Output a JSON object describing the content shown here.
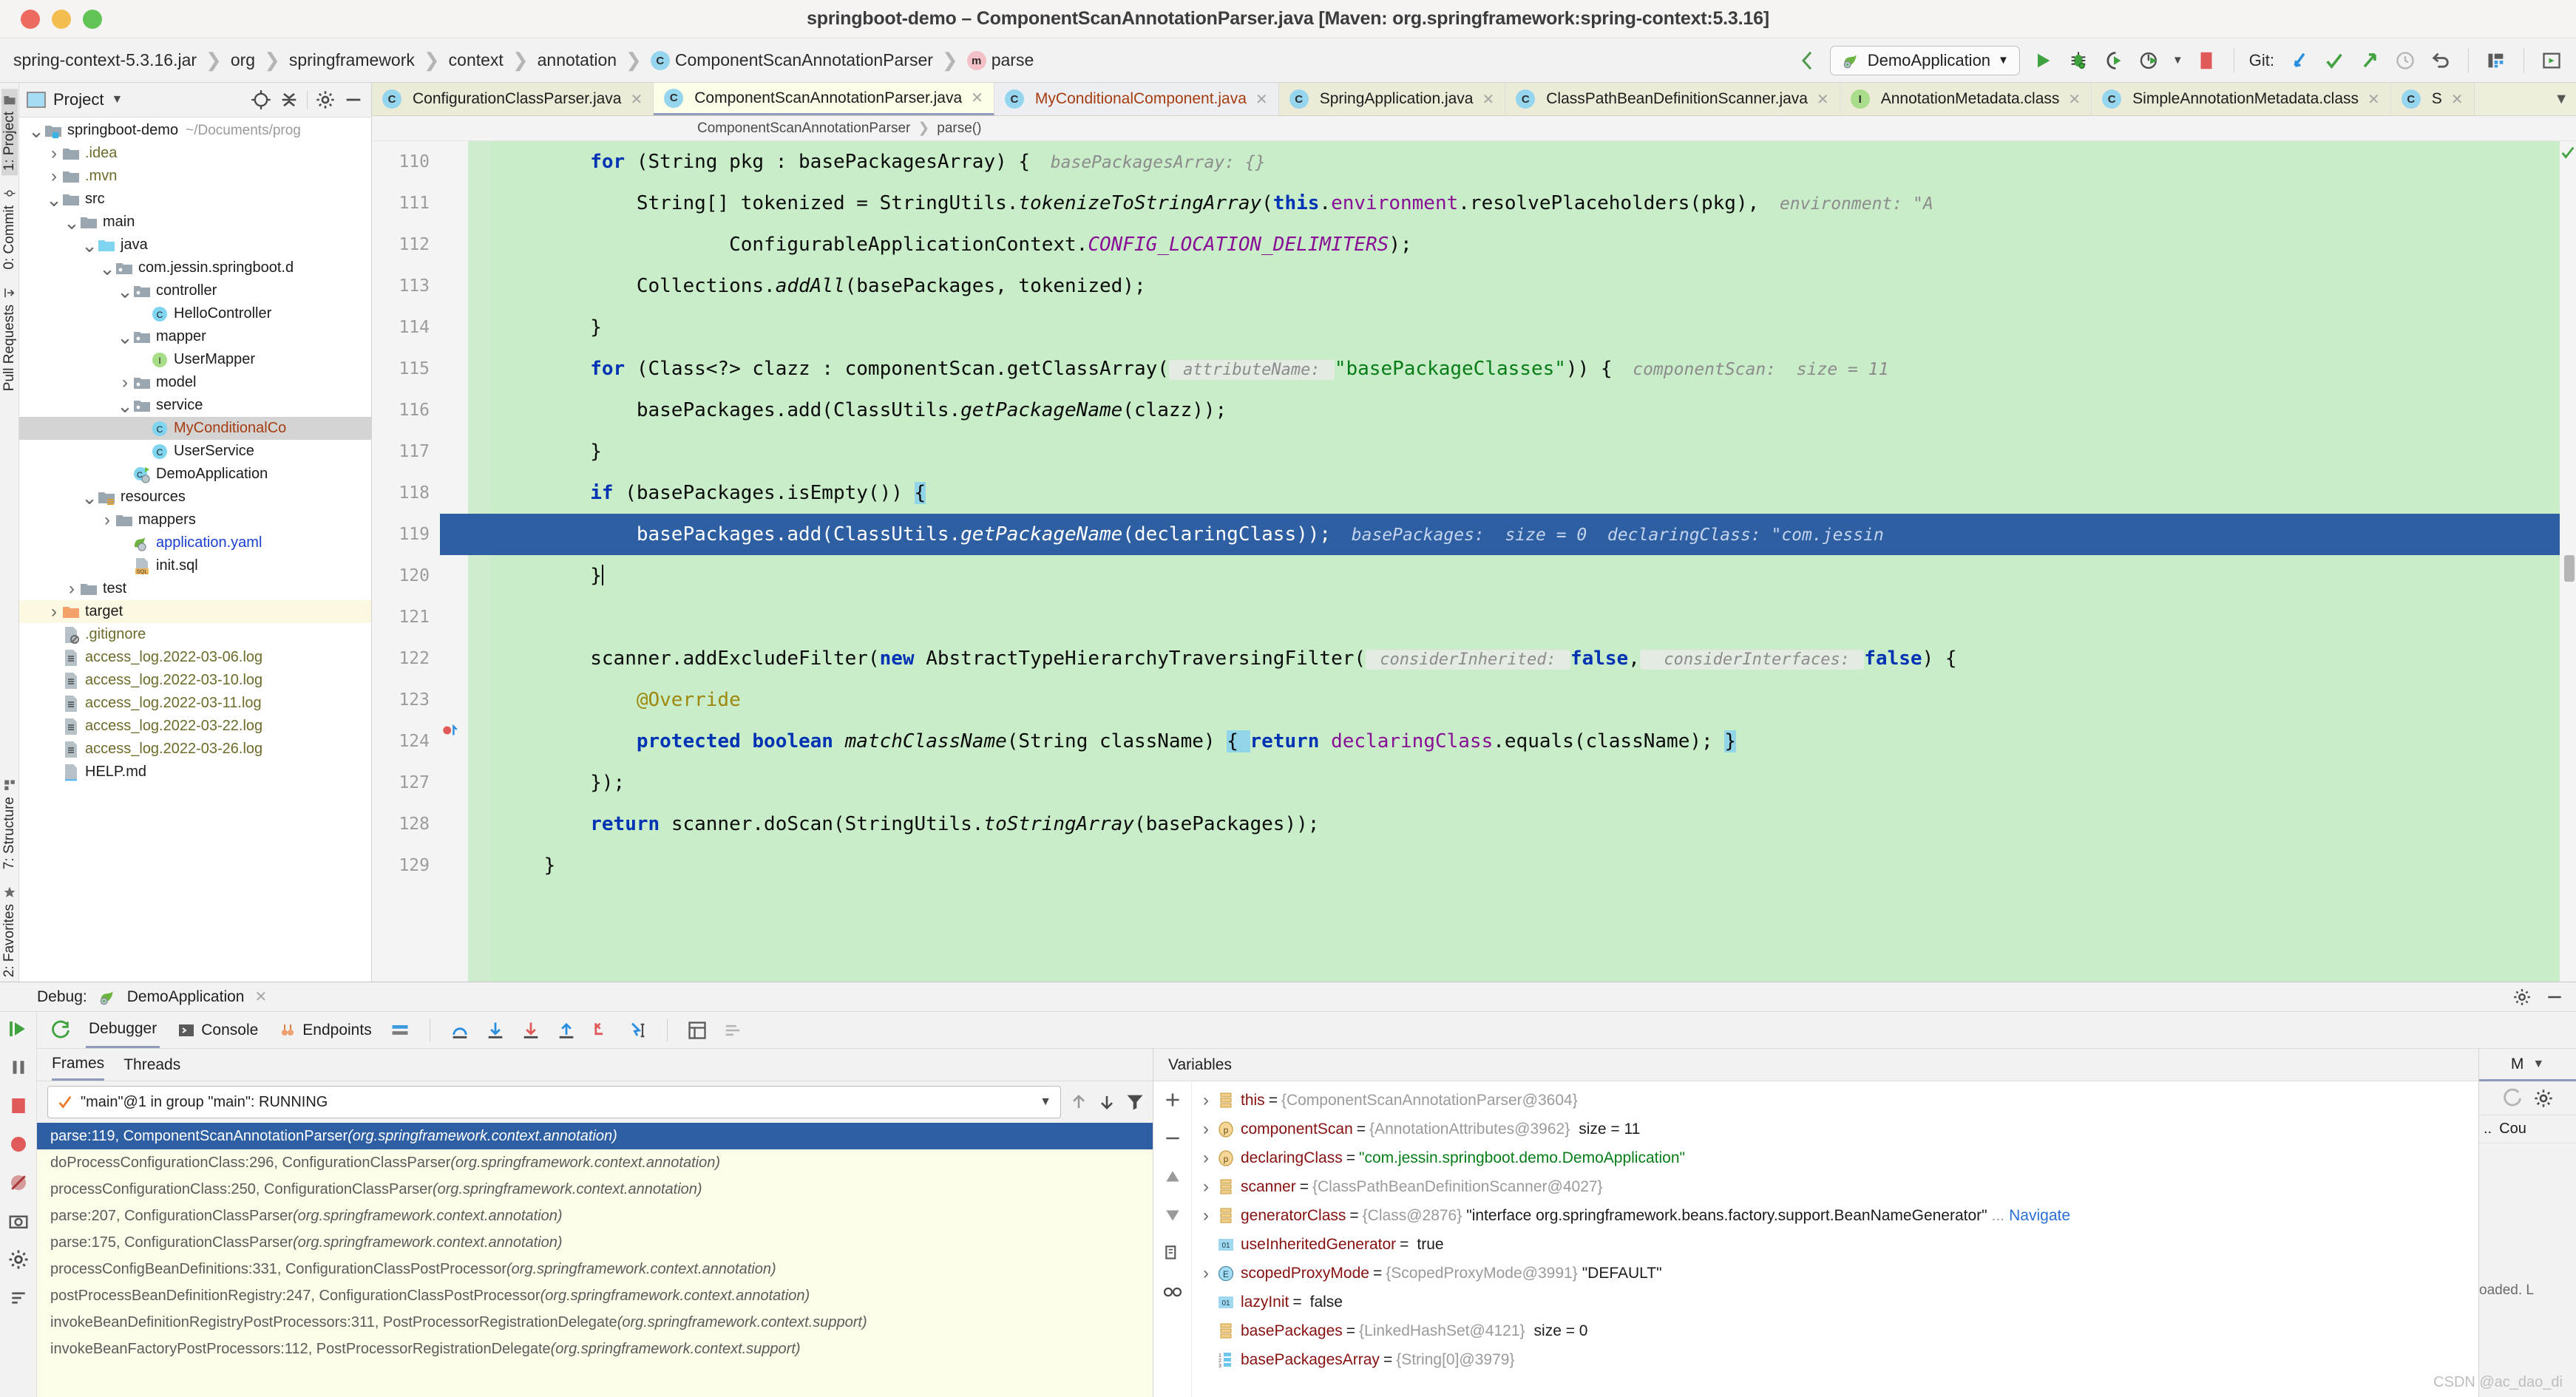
{
  "window": {
    "title": "springboot-demo – ComponentScanAnnotationParser.java [Maven: org.springframework:spring-context:5.3.16]",
    "traffic_lights": [
      "close-red",
      "minimize-yellow",
      "maximize-green"
    ]
  },
  "navbar": {
    "breadcrumbs": [
      {
        "label": "spring-context-5.3.16.jar",
        "icon": null
      },
      {
        "label": "org",
        "icon": null
      },
      {
        "label": "springframework",
        "icon": null
      },
      {
        "label": "context",
        "icon": null
      },
      {
        "label": "annotation",
        "icon": null
      },
      {
        "label": "ComponentScanAnnotationParser",
        "icon": "class-badge",
        "badge": "C"
      },
      {
        "label": "parse",
        "icon": "method-badge",
        "badge": "m"
      }
    ],
    "run_config": "DemoApplication",
    "git_label": "Git:",
    "icons": [
      "back-arrow-icon",
      "run-icon",
      "debug-icon",
      "run-with-coverage-icon",
      "profiler-icon",
      "stop-icon",
      "git-update-icon",
      "git-commit-icon",
      "git-push-icon",
      "git-history-icon",
      "git-rollback-icon",
      "build-icon",
      "search-everywhere-icon"
    ]
  },
  "left_strip": {
    "items": [
      {
        "label": "1: Project",
        "icon": "folder-icon",
        "active": true
      },
      {
        "label": "0: Commit",
        "icon": "commit-icon",
        "active": false
      },
      {
        "label": "Pull Requests",
        "icon": "pull-request-icon",
        "active": false
      }
    ],
    "bottom_items": [
      {
        "label": "7: Structure",
        "icon": "structure-icon"
      },
      {
        "label": "2: Favorites",
        "icon": "star-icon"
      }
    ]
  },
  "project_panel": {
    "header_title": "Project",
    "header_icons": [
      "project-scope-icon",
      "locate-icon",
      "collapse-all-icon",
      "settings-gear-icon",
      "hide-icon"
    ],
    "tree": [
      {
        "indent": 0,
        "twisty": "v",
        "icon": "module-folder",
        "label": "springboot-demo",
        "path": "~/Documents/prog",
        "style": "dir"
      },
      {
        "indent": 1,
        "twisty": ">",
        "icon": "folder",
        "label": ".idea",
        "style": "olive"
      },
      {
        "indent": 1,
        "twisty": ">",
        "icon": "folder",
        "label": ".mvn",
        "style": "olive"
      },
      {
        "indent": 1,
        "twisty": "v",
        "icon": "folder",
        "label": "src",
        "style": "dir"
      },
      {
        "indent": 2,
        "twisty": "v",
        "icon": "folder",
        "label": "main",
        "style": "dir"
      },
      {
        "indent": 3,
        "twisty": "v",
        "icon": "source-folder",
        "label": "java",
        "style": "dir"
      },
      {
        "indent": 4,
        "twisty": "v",
        "icon": "package",
        "label": "com.jessin.springboot.d",
        "style": "dir"
      },
      {
        "indent": 5,
        "twisty": "v",
        "icon": "package",
        "label": "controller",
        "style": "dir"
      },
      {
        "indent": 6,
        "twisty": "",
        "icon": "class",
        "label": "HelloController",
        "style": "dir"
      },
      {
        "indent": 5,
        "twisty": "v",
        "icon": "package",
        "label": "mapper",
        "style": "dir"
      },
      {
        "indent": 6,
        "twisty": "",
        "icon": "interface",
        "label": "UserMapper",
        "style": "dir"
      },
      {
        "indent": 5,
        "twisty": ">",
        "icon": "package",
        "label": "model",
        "style": "dir"
      },
      {
        "indent": 5,
        "twisty": "v",
        "icon": "package",
        "label": "service",
        "style": "dir"
      },
      {
        "indent": 6,
        "twisty": "",
        "icon": "class",
        "label": "MyConditionalCo",
        "style": "orange",
        "selected": true
      },
      {
        "indent": 6,
        "twisty": "",
        "icon": "class",
        "label": "UserService",
        "style": "dir"
      },
      {
        "indent": 5,
        "twisty": "",
        "icon": "spring-class",
        "label": "DemoApplication",
        "style": "dir"
      },
      {
        "indent": 3,
        "twisty": "v",
        "icon": "resources-folder",
        "label": "resources",
        "style": "dir"
      },
      {
        "indent": 4,
        "twisty": ">",
        "icon": "folder",
        "label": "mappers",
        "style": "dir"
      },
      {
        "indent": 5,
        "twisty": "",
        "icon": "spring-yaml",
        "label": "application.yaml",
        "style": "blue"
      },
      {
        "indent": 5,
        "twisty": "",
        "icon": "sql-file",
        "label": "init.sql",
        "style": "dir"
      },
      {
        "indent": 2,
        "twisty": ">",
        "icon": "folder",
        "label": "test",
        "style": "dir"
      },
      {
        "indent": 1,
        "twisty": ">",
        "icon": "target-folder",
        "label": "target",
        "style": "dir",
        "highlight": true
      },
      {
        "indent": 1,
        "twisty": "",
        "icon": "gitignore-file",
        "label": ".gitignore",
        "style": "olive"
      },
      {
        "indent": 1,
        "twisty": "",
        "icon": "log-file",
        "label": "access_log.2022-03-06.log",
        "style": "olive"
      },
      {
        "indent": 1,
        "twisty": "",
        "icon": "log-file",
        "label": "access_log.2022-03-10.log",
        "style": "olive"
      },
      {
        "indent": 1,
        "twisty": "",
        "icon": "log-file",
        "label": "access_log.2022-03-11.log",
        "style": "olive"
      },
      {
        "indent": 1,
        "twisty": "",
        "icon": "log-file",
        "label": "access_log.2022-03-22.log",
        "style": "olive"
      },
      {
        "indent": 1,
        "twisty": "",
        "icon": "log-file",
        "label": "access_log.2022-03-26.log",
        "style": "olive"
      },
      {
        "indent": 1,
        "twisty": "",
        "icon": "md-file",
        "label": "HELP.md",
        "style": "dir"
      }
    ]
  },
  "editor": {
    "tabs": [
      {
        "label": "ConfigurationClassParser.java",
        "badge": "C",
        "state": "normal"
      },
      {
        "label": "ComponentScanAnnotationParser.java",
        "badge": "C",
        "state": "selected"
      },
      {
        "label": "MyConditionalComponent.java",
        "badge": "C",
        "state": "dim",
        "color": "orange"
      },
      {
        "label": "SpringApplication.java",
        "badge": "C",
        "state": "normal"
      },
      {
        "label": "ClassPathBeanDefinitionScanner.java",
        "badge": "C",
        "state": "normal"
      },
      {
        "label": "AnnotationMetadata.class",
        "badge": "I",
        "state": "normal"
      },
      {
        "label": "SimpleAnnotationMetadata.class",
        "badge": "C",
        "state": "normal"
      },
      {
        "label": "S",
        "badge": "C",
        "state": "normal"
      }
    ],
    "breadcrumb": [
      "ComponentScanAnnotationParser",
      "parse()"
    ],
    "lines": [
      {
        "n": "110",
        "indent": 2,
        "partial": true,
        "tokens": [
          {
            "t": "for ",
            "c": "kw"
          },
          {
            "t": "(String pkg : basePackagesArray) {",
            "c": ""
          },
          {
            "t": "  basePackagesArray: {}",
            "c": "hint"
          }
        ]
      },
      {
        "n": "111",
        "indent": 3,
        "tokens": [
          {
            "t": "String[] tokenized = StringUtils.",
            "c": ""
          },
          {
            "t": "tokenizeToStringArray",
            "c": "mth"
          },
          {
            "t": "(",
            "c": ""
          },
          {
            "t": "this",
            "c": "kw"
          },
          {
            "t": ".",
            "c": ""
          },
          {
            "t": "environment",
            "c": "fld"
          },
          {
            "t": ".resolvePlaceholders(pkg),",
            "c": ""
          },
          {
            "t": "  environment: \"A",
            "c": "hint"
          }
        ]
      },
      {
        "n": "112",
        "indent": 5,
        "tokens": [
          {
            "t": "ConfigurableApplicationContext.",
            "c": ""
          },
          {
            "t": "CONFIG_LOCATION_DELIMITERS",
            "c": "stat"
          },
          {
            "t": ");",
            "c": ""
          }
        ]
      },
      {
        "n": "113",
        "indent": 3,
        "tokens": [
          {
            "t": "Collections.",
            "c": ""
          },
          {
            "t": "addAll",
            "c": "mth"
          },
          {
            "t": "(basePackages, tokenized);",
            "c": ""
          }
        ]
      },
      {
        "n": "114",
        "indent": 2,
        "tokens": [
          {
            "t": "}",
            "c": ""
          }
        ]
      },
      {
        "n": "115",
        "indent": 2,
        "tokens": [
          {
            "t": "for ",
            "c": "kw"
          },
          {
            "t": "(Class<?> clazz : componentScan.getClassArray(",
            "c": ""
          },
          {
            "t": " attributeName: ",
            "c": "hintbox"
          },
          {
            "t": "\"basePackageClasses\"",
            "c": "str"
          },
          {
            "t": ")) {",
            "c": ""
          },
          {
            "t": "  componentScan:  size = 11",
            "c": "hint"
          }
        ]
      },
      {
        "n": "116",
        "indent": 3,
        "tokens": [
          {
            "t": "basePackages.add(ClassUtils.",
            "c": ""
          },
          {
            "t": "getPackageName",
            "c": "mth"
          },
          {
            "t": "(clazz));",
            "c": ""
          }
        ]
      },
      {
        "n": "117",
        "indent": 2,
        "tokens": [
          {
            "t": "}",
            "c": ""
          }
        ]
      },
      {
        "n": "118",
        "indent": 2,
        "tokens": [
          {
            "t": "if ",
            "c": "kw"
          },
          {
            "t": "(basePackages.isEmpty()) ",
            "c": ""
          },
          {
            "t": "{",
            "c": "brace"
          }
        ]
      },
      {
        "n": "119",
        "indent": 3,
        "selected": true,
        "tokens": [
          {
            "t": "basePackages.add(ClassUtils.",
            "c": ""
          },
          {
            "t": "getPackageName",
            "c": "mth"
          },
          {
            "t": "(declaringClass));",
            "c": ""
          },
          {
            "t": "  basePackages:  size = 0  declaringClass: \"com.jessin",
            "c": "hint"
          }
        ]
      },
      {
        "n": "120",
        "indent": 2,
        "caret": true,
        "tokens": [
          {
            "t": "}",
            "c": ""
          }
        ]
      },
      {
        "n": "121",
        "indent": 0,
        "tokens": []
      },
      {
        "n": "122",
        "indent": 2,
        "tokens": [
          {
            "t": "scanner.addExcludeFilter(",
            "c": ""
          },
          {
            "t": "new ",
            "c": "kw"
          },
          {
            "t": "AbstractTypeHierarchyTraversingFilter(",
            "c": ""
          },
          {
            "t": " considerInherited: ",
            "c": "hintbox"
          },
          {
            "t": "false",
            "c": "kw"
          },
          {
            "t": ",",
            "c": ""
          },
          {
            "t": "  considerInterfaces: ",
            "c": "hintbox"
          },
          {
            "t": "false",
            "c": "kw"
          },
          {
            "t": ") {",
            "c": ""
          }
        ]
      },
      {
        "n": "123",
        "indent": 3,
        "tokens": [
          {
            "t": "@Override",
            "c": "ann"
          }
        ]
      },
      {
        "n": "124",
        "indent": 3,
        "bookmark": true,
        "tokens": [
          {
            "t": "protected ",
            "c": "kw"
          },
          {
            "t": "boolean ",
            "c": "kw"
          },
          {
            "t": "matchClassName",
            "c": "mth"
          },
          {
            "t": "(String className) ",
            "c": ""
          },
          {
            "t": "{ ",
            "c": "brace"
          },
          {
            "t": "return ",
            "c": "kw"
          },
          {
            "t": "declaringClass",
            "c": "fld"
          },
          {
            "t": ".equals(className); ",
            "c": ""
          },
          {
            "t": "}",
            "c": "brace"
          }
        ]
      },
      {
        "n": "127",
        "indent": 2,
        "tokens": [
          {
            "t": "});",
            "c": ""
          }
        ]
      },
      {
        "n": "128",
        "indent": 2,
        "tokens": [
          {
            "t": "return ",
            "c": "kw"
          },
          {
            "t": "scanner.doScan(StringUtils.",
            "c": ""
          },
          {
            "t": "toStringArray",
            "c": "mth"
          },
          {
            "t": "(basePackages));",
            "c": ""
          }
        ]
      },
      {
        "n": "129",
        "indent": 1,
        "tokens": [
          {
            "t": "}",
            "c": ""
          }
        ]
      }
    ]
  },
  "debug": {
    "title_label": "Debug:",
    "session_name": "DemoApplication",
    "header_icons": [
      "settings-gear-icon",
      "hide-icon"
    ],
    "tabs": [
      {
        "label": "Debugger",
        "icon": null,
        "active": true
      },
      {
        "label": "Console",
        "icon": "console-icon",
        "active": false
      },
      {
        "label": "Endpoints",
        "icon": "endpoints-icon",
        "active": false
      }
    ],
    "toolbar_icons": [
      "rerun-icon",
      "layout-icon",
      "step-over-icon",
      "step-into-icon",
      "force-step-into-icon",
      "step-out-icon",
      "drop-frame-icon",
      "run-to-cursor-icon",
      "evaluate-expression-icon",
      "settings-icon"
    ],
    "side_icons": [
      "resume-icon",
      "pause-icon",
      "stop-icon",
      "view-breakpoints-icon",
      "mute-breakpoints-icon",
      "camera-icon",
      "settings-gear-icon",
      "sort-icon"
    ],
    "frames": {
      "tabs": [
        {
          "label": "Frames",
          "active": true
        },
        {
          "label": "Threads",
          "active": false
        }
      ],
      "thread_selector": "\"main\"@1 in group \"main\": RUNNING",
      "nav_icons": [
        "up-arrow-icon",
        "down-arrow-icon",
        "filter-icon"
      ],
      "stack": [
        {
          "method": "parse:119, ComponentScanAnnotationParser",
          "pkg": "(org.springframework.context.annotation)",
          "selected": true
        },
        {
          "method": "doProcessConfigurationClass:296, ConfigurationClassParser",
          "pkg": "(org.springframework.context.annotation)"
        },
        {
          "method": "processConfigurationClass:250, ConfigurationClassParser",
          "pkg": "(org.springframework.context.annotation)"
        },
        {
          "method": "parse:207, ConfigurationClassParser",
          "pkg": "(org.springframework.context.annotation)"
        },
        {
          "method": "parse:175, ConfigurationClassParser",
          "pkg": "(org.springframework.context.annotation)"
        },
        {
          "method": "processConfigBeanDefinitions:331, ConfigurationClassPostProcessor",
          "pkg": "(org.springframework.context.annotation)"
        },
        {
          "method": "postProcessBeanDefinitionRegistry:247, ConfigurationClassPostProcessor",
          "pkg": "(org.springframework.context.annotation)"
        },
        {
          "method": "invokeBeanDefinitionRegistryPostProcessors:311, PostProcessorRegistrationDelegate",
          "pkg": "(org.springframework.context.support)"
        },
        {
          "method": "invokeBeanFactoryPostProcessors:112, PostProcessorRegistrationDelegate",
          "pkg": "(org.springframework.context.support)"
        }
      ]
    },
    "variables": {
      "title": "Variables",
      "tool_icons": [
        "add-icon",
        "remove-icon",
        "scroll-up-icon",
        "scroll-down-icon",
        "copy-icon",
        "infinity-icon"
      ],
      "rows": [
        {
          "chev": ">",
          "icon": "object-icon",
          "name": "this",
          "eq": "=",
          "ref": "{ComponentScanAnnotationParser@3604}"
        },
        {
          "chev": ">",
          "icon": "param-icon",
          "name": "componentScan",
          "eq": "=",
          "ref": "{AnnotationAttributes@3962}",
          "size": "size = 11"
        },
        {
          "chev": ">",
          "icon": "param-icon",
          "name": "declaringClass",
          "eq": "=",
          "str": "\"com.jessin.springboot.demo.DemoApplication\""
        },
        {
          "chev": ">",
          "icon": "object-icon",
          "name": "scanner",
          "eq": "=",
          "ref": "{ClassPathBeanDefinitionScanner@4027}"
        },
        {
          "chev": ">",
          "icon": "object-icon",
          "name": "generatorClass",
          "eq": "=",
          "ref": "{Class@2876}",
          "plain": "\"interface org.springframework.beans.factory.support.BeanNameGenerator\"",
          "ellipsis": "...",
          "link": "Navigate"
        },
        {
          "chev": "",
          "icon": "bool-icon",
          "name": "useInheritedGenerator",
          "eq": "=",
          "plain": "true"
        },
        {
          "chev": ">",
          "icon": "enum-icon",
          "name": "scopedProxyMode",
          "eq": "=",
          "ref": "{ScopedProxyMode@3991}",
          "plain": "\"DEFAULT\""
        },
        {
          "chev": "",
          "icon": "bool-icon",
          "name": "lazyInit",
          "eq": "=",
          "plain": "false"
        },
        {
          "chev": "",
          "icon": "object-icon",
          "name": "basePackages",
          "eq": "=",
          "ref": "{LinkedHashSet@4121}",
          "size": "size = 0"
        },
        {
          "chev": "",
          "icon": "array-icon",
          "name": "basePackagesArray",
          "eq": "=",
          "ref": "{String[0]@3979}"
        }
      ]
    },
    "right_strip": {
      "tab_label": "M",
      "col_header": "Cou",
      "col_ellipsis": "..",
      "note": "oaded. L",
      "icons": [
        "refresh-icon",
        "settings-gear-icon",
        "chevron-down-icon"
      ]
    }
  },
  "watermark": "CSDN @ac_dao_di",
  "colors": {
    "accent_blue": "#2e5fa3",
    "exec_line_green": "#c9ecc9",
    "tab_yellow": "#fdfde8",
    "frame_yellow": "#fcfce8",
    "string_green": "#067d17",
    "keyword_blue": "#0033b3",
    "static_purple": "#871094",
    "var_name_red": "#871010",
    "orange_file": "#a63c10"
  }
}
